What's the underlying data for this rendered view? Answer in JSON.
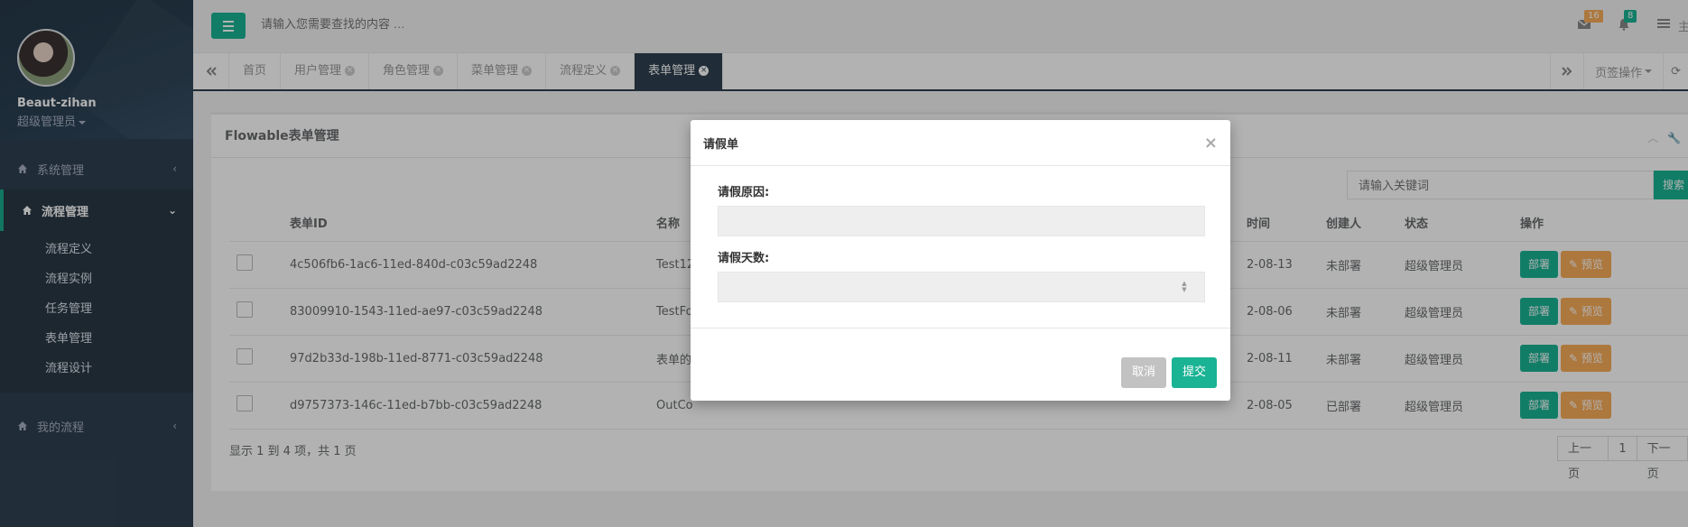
{
  "sidebar": {
    "user_name": "Beaut-zihan",
    "user_role": "超级管理员",
    "menus": [
      {
        "label": "系统管理",
        "chevron": "‹"
      },
      {
        "label": "流程管理",
        "chevron": "⌄"
      },
      {
        "label": "我的流程",
        "chevron": "‹"
      }
    ],
    "submenu": [
      "流程定义",
      "流程实例",
      "任务管理",
      "表单管理",
      "流程设计"
    ]
  },
  "topbar": {
    "search_placeholder": "请输入您需要查找的内容 …",
    "mail_count": "16",
    "bell_count": "8",
    "extra": "主"
  },
  "tabs": {
    "items": [
      "首页",
      "用户管理",
      "角色管理",
      "菜单管理",
      "流程定义",
      "表单管理"
    ],
    "tab_ops": "页签操作"
  },
  "panel": {
    "title": "Flowable表单管理",
    "search_placeholder": "请输入关键词",
    "search_btn": "搜索",
    "columns": [
      "表单ID",
      "名称",
      "时间",
      "创建人",
      "状态",
      "操作"
    ],
    "rows": [
      {
        "id": "4c506fb6-1ac6-11ed-840d-c03c59ad2248",
        "name": "Test12",
        "date": "2-08-13",
        "creator": "未部署",
        "status": "超级管理员"
      },
      {
        "id": "83009910-1543-11ed-ae97-c03c59ad2248",
        "name": "TestFo",
        "date": "2-08-06",
        "creator": "未部署",
        "status": "超级管理员"
      },
      {
        "id": "97d2b33d-198b-11ed-8771-c03c59ad2248",
        "name": "表单的",
        "date": "2-08-11",
        "creator": "未部署",
        "status": "超级管理员"
      },
      {
        "id": "d9757373-146c-11ed-b7bb-c03c59ad2248",
        "name": "OutCo",
        "date": "2-08-05",
        "creator": "已部署",
        "status": "超级管理员"
      }
    ],
    "deploy_label": "部署",
    "preview_label": "预览",
    "pager_info": "显示 1 到 4 项，共 1 页",
    "pager": {
      "prev": "上一页",
      "page": "1",
      "next": "下一页"
    }
  },
  "modal": {
    "title": "请假单",
    "close": "×",
    "field1_label": "请假原因:",
    "field2_label": "请假天数:",
    "cancel": "取消",
    "submit": "提交"
  },
  "colors": {
    "accent": "#1ab394",
    "sidebar": "#2f4050",
    "warning": "#f8ac59"
  }
}
